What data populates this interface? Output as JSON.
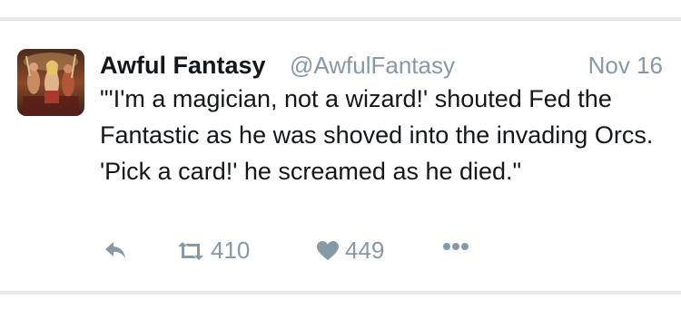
{
  "tweet": {
    "author_name": "Awful Fantasy",
    "handle": "@AwfulFantasy",
    "date": "Nov 16",
    "text": "\"'I'm a magician, not a wizard!' shouted Fed the Fantastic as he was shoved into the invading Orcs. 'Pick a card!' he screamed as he died.\"",
    "avatar_icon": "fantasy-art-avatar"
  },
  "actions": {
    "reply_icon": "reply-icon",
    "retweet_icon": "retweet-icon",
    "retweet_count": "410",
    "like_icon": "heart-icon",
    "like_count": "449",
    "more_icon": "more-dots-icon"
  },
  "colors": {
    "text_primary": "#14171a",
    "text_secondary": "#8899a6",
    "border": "#dfe3e6",
    "background": "#e8ecef"
  }
}
